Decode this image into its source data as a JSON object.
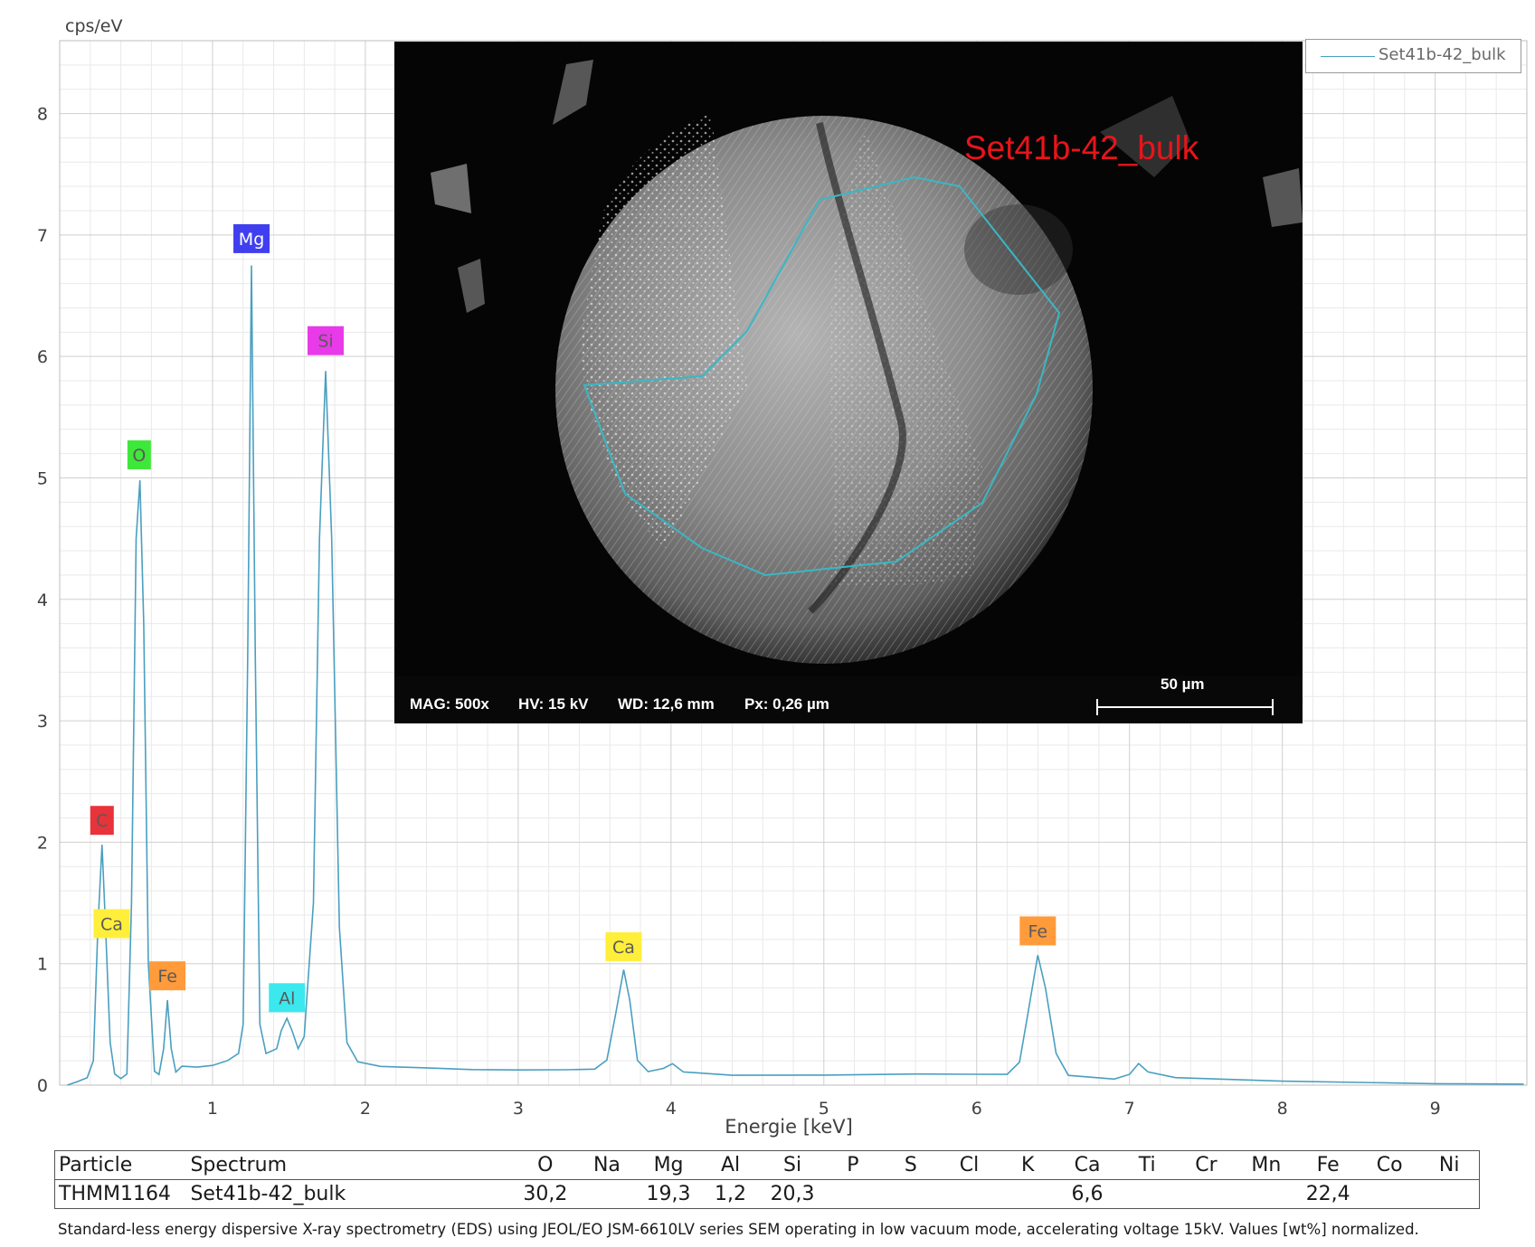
{
  "chart_data": {
    "type": "line",
    "ylabel": "cps/eV",
    "xlabel": "Energie [keV]",
    "xlim": [
      0.0,
      9.6
    ],
    "ylim": [
      0,
      8.6
    ],
    "x_ticks": [
      1,
      2,
      3,
      4,
      5,
      6,
      7,
      8,
      9
    ],
    "y_ticks": [
      0,
      1,
      2,
      3,
      4,
      5,
      6,
      7,
      8
    ],
    "grid": true,
    "legend_position": "top-right",
    "series": [
      {
        "name": "Set41b-42_bulk",
        "color": "#4a9fc0",
        "points": [
          [
            0.05,
            0.0
          ],
          [
            0.12,
            0.02
          ],
          [
            0.18,
            0.05
          ],
          [
            0.22,
            0.2
          ],
          [
            0.25,
            1.3
          ],
          [
            0.277,
            1.98
          ],
          [
            0.3,
            1.3
          ],
          [
            0.33,
            0.35
          ],
          [
            0.36,
            0.08
          ],
          [
            0.4,
            0.05
          ],
          [
            0.44,
            0.1
          ],
          [
            0.47,
            1.5
          ],
          [
            0.5,
            4.5
          ],
          [
            0.525,
            4.98
          ],
          [
            0.55,
            3.8
          ],
          [
            0.58,
            1.0
          ],
          [
            0.62,
            0.12
          ],
          [
            0.65,
            0.1
          ],
          [
            0.68,
            0.3
          ],
          [
            0.705,
            0.7
          ],
          [
            0.73,
            0.3
          ],
          [
            0.76,
            0.1
          ],
          [
            0.8,
            0.16
          ],
          [
            0.9,
            0.16
          ],
          [
            1.0,
            0.17
          ],
          [
            1.1,
            0.2
          ],
          [
            1.17,
            0.25
          ],
          [
            1.2,
            0.5
          ],
          [
            1.23,
            3.5
          ],
          [
            1.255,
            6.75
          ],
          [
            1.28,
            3.5
          ],
          [
            1.31,
            0.5
          ],
          [
            1.35,
            0.25
          ],
          [
            1.42,
            0.3
          ],
          [
            1.45,
            0.45
          ],
          [
            1.487,
            0.55
          ],
          [
            1.52,
            0.45
          ],
          [
            1.56,
            0.3
          ],
          [
            1.6,
            0.4
          ],
          [
            1.66,
            1.5
          ],
          [
            1.7,
            4.5
          ],
          [
            1.74,
            5.88
          ],
          [
            1.78,
            4.5
          ],
          [
            1.83,
            1.3
          ],
          [
            1.88,
            0.35
          ],
          [
            1.95,
            0.18
          ],
          [
            2.1,
            0.15
          ],
          [
            2.4,
            0.15
          ],
          [
            2.7,
            0.14
          ],
          [
            3.0,
            0.13
          ],
          [
            3.3,
            0.12
          ],
          [
            3.5,
            0.12
          ],
          [
            3.58,
            0.2
          ],
          [
            3.64,
            0.6
          ],
          [
            3.69,
            0.95
          ],
          [
            3.73,
            0.7
          ],
          [
            3.78,
            0.2
          ],
          [
            3.85,
            0.1
          ],
          [
            3.95,
            0.13
          ],
          [
            4.01,
            0.18
          ],
          [
            4.08,
            0.12
          ],
          [
            4.4,
            0.09
          ],
          [
            5.0,
            0.08
          ],
          [
            5.6,
            0.08
          ],
          [
            6.0,
            0.08
          ],
          [
            6.2,
            0.09
          ],
          [
            6.28,
            0.2
          ],
          [
            6.33,
            0.55
          ],
          [
            6.4,
            1.07
          ],
          [
            6.45,
            0.8
          ],
          [
            6.52,
            0.25
          ],
          [
            6.6,
            0.08
          ],
          [
            6.9,
            0.06
          ],
          [
            7.0,
            0.1
          ],
          [
            7.06,
            0.18
          ],
          [
            7.12,
            0.1
          ],
          [
            7.3,
            0.05
          ],
          [
            8.0,
            0.03
          ],
          [
            9.0,
            0.02
          ],
          [
            9.58,
            0.02
          ]
        ]
      }
    ],
    "peak_labels": [
      {
        "text": "C",
        "x": 0.277,
        "y": 2.18,
        "color": "#e8333a"
      },
      {
        "text": "Ca",
        "x": 0.34,
        "y": 1.33,
        "color": "#ffef3a"
      },
      {
        "text": "O",
        "x": 0.52,
        "y": 5.19,
        "color": "#3ee83a"
      },
      {
        "text": "Fe",
        "x": 0.705,
        "y": 0.9,
        "color": "#ff9b3a"
      },
      {
        "text": "Mg",
        "x": 1.255,
        "y": 6.97,
        "color": "#3f3ff0"
      },
      {
        "text": "Al",
        "x": 1.487,
        "y": 0.72,
        "color": "#3ae8ee"
      },
      {
        "text": "Si",
        "x": 1.74,
        "y": 6.13,
        "color": "#e83ae8"
      },
      {
        "text": "Ca",
        "x": 3.69,
        "y": 1.14,
        "color": "#ffef3a"
      },
      {
        "text": "Fe",
        "x": 6.4,
        "y": 1.27,
        "color": "#ff9b3a"
      }
    ]
  },
  "sem_image": {
    "label": "Set41b-42_bulk",
    "mag": "MAG: 500x",
    "hv": "HV: 15 kV",
    "wd": "WD: 12,6 mm",
    "px": "Px: 0,26 µm",
    "scale_bar": "50 µm"
  },
  "table": {
    "headers": [
      "Particle",
      "Spectrum",
      "O",
      "Na",
      "Mg",
      "Al",
      "Si",
      "P",
      "S",
      "Cl",
      "K",
      "Ca",
      "Ti",
      "Cr",
      "Mn",
      "Fe",
      "Co",
      "Ni"
    ],
    "row": [
      "THMM1164",
      "Set41b-42_bulk",
      "30,2",
      "",
      "19,3",
      "1,2",
      "20,3",
      "",
      "",
      "",
      "",
      "6,6",
      "",
      "",
      "",
      "22,4",
      "",
      ""
    ]
  },
  "footnote": "Standard-less energy dispersive X-ray spectrometry (EDS) using JEOL/EO JSM-6610LV series SEM operating in low vacuum mode, accelerating voltage 15kV. Values [wt%] normalized."
}
